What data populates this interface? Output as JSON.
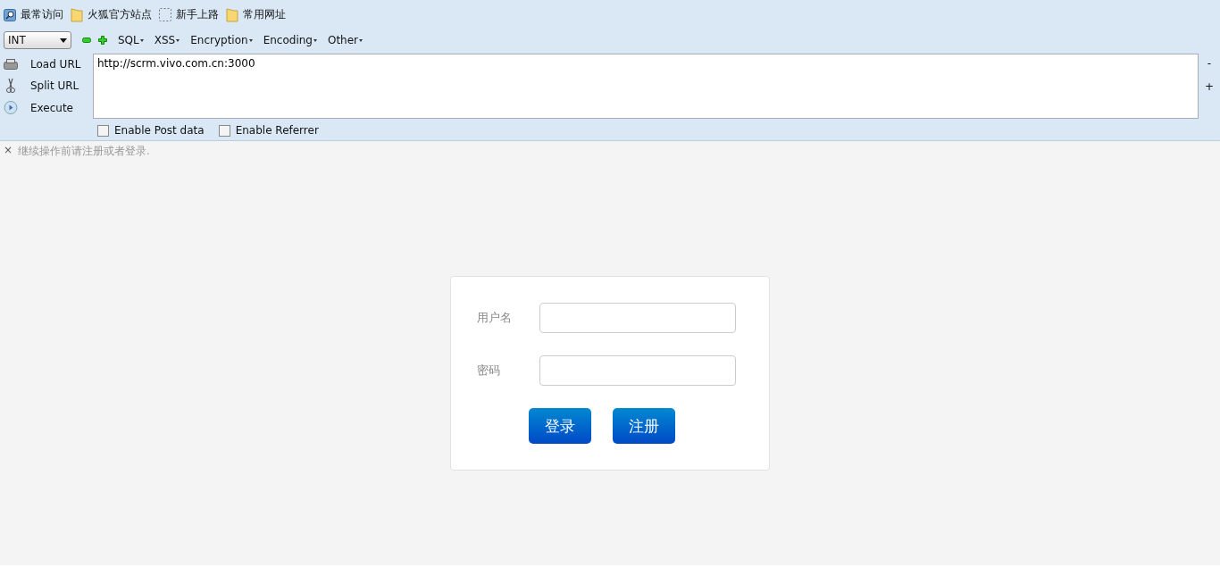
{
  "bookmarks": [
    {
      "kind": "search",
      "label": "最常访问"
    },
    {
      "kind": "folder",
      "label": "火狐官方站点"
    },
    {
      "kind": "blank",
      "label": "新手上路"
    },
    {
      "kind": "folder",
      "label": "常用网址"
    }
  ],
  "hackbar": {
    "select": "INT",
    "menus": [
      "SQL",
      "XSS",
      "Encryption",
      "Encoding",
      "Other"
    ],
    "actions": [
      {
        "kind": "load",
        "label": "Load URL"
      },
      {
        "kind": "split",
        "label": "Split URL"
      },
      {
        "kind": "execute",
        "label": "Execute"
      }
    ],
    "url": "http://scrm.vivo.com.cn:3000",
    "side_buttons": [
      "-",
      "+"
    ],
    "options": [
      {
        "label": "Enable Post data",
        "checked": false
      },
      {
        "label": "Enable Referrer",
        "checked": false
      }
    ]
  },
  "notice": {
    "close": "×",
    "text": "继续操作前请注册或者登录."
  },
  "login": {
    "fields": [
      {
        "label": "用户名"
      },
      {
        "label": "密码"
      }
    ],
    "buttons": [
      "登录",
      "注册"
    ]
  }
}
